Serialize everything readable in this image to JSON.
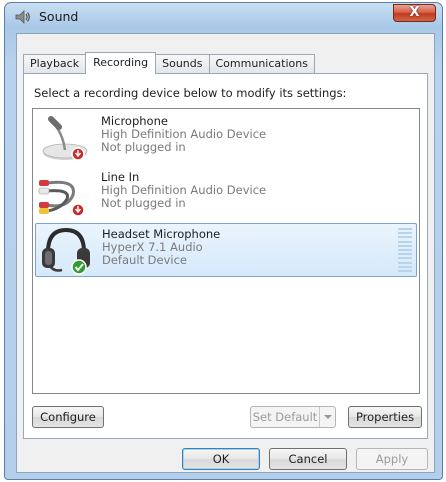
{
  "window": {
    "title": "Sound",
    "close_label": "X"
  },
  "tabs": [
    {
      "label": "Playback",
      "active": false
    },
    {
      "label": "Recording",
      "active": true
    },
    {
      "label": "Sounds",
      "active": false
    },
    {
      "label": "Communications",
      "active": false
    }
  ],
  "instruction": "Select a recording device below to modify its settings:",
  "devices": [
    {
      "name": "Microphone",
      "description": "High Definition Audio Device",
      "status": "Not plugged in",
      "icon": "microphone-icon",
      "badge": "unplugged-badge-icon",
      "selected": false
    },
    {
      "name": "Line In",
      "description": "High Definition Audio Device",
      "status": "Not plugged in",
      "icon": "line-in-cable-icon",
      "badge": "unplugged-badge-icon",
      "selected": false
    },
    {
      "name": "Headset Microphone",
      "description": "HyperX 7.1 Audio",
      "status": "Default Device",
      "icon": "headset-icon",
      "badge": "default-checkmark-icon",
      "selected": true
    }
  ],
  "buttons": {
    "configure": "Configure",
    "set_default": "Set Default",
    "properties": "Properties",
    "ok": "OK",
    "cancel": "Cancel",
    "apply": "Apply"
  },
  "colors": {
    "selection": "#d6e9fb",
    "close": "#c33a21",
    "accent": "#3c7fb1"
  }
}
